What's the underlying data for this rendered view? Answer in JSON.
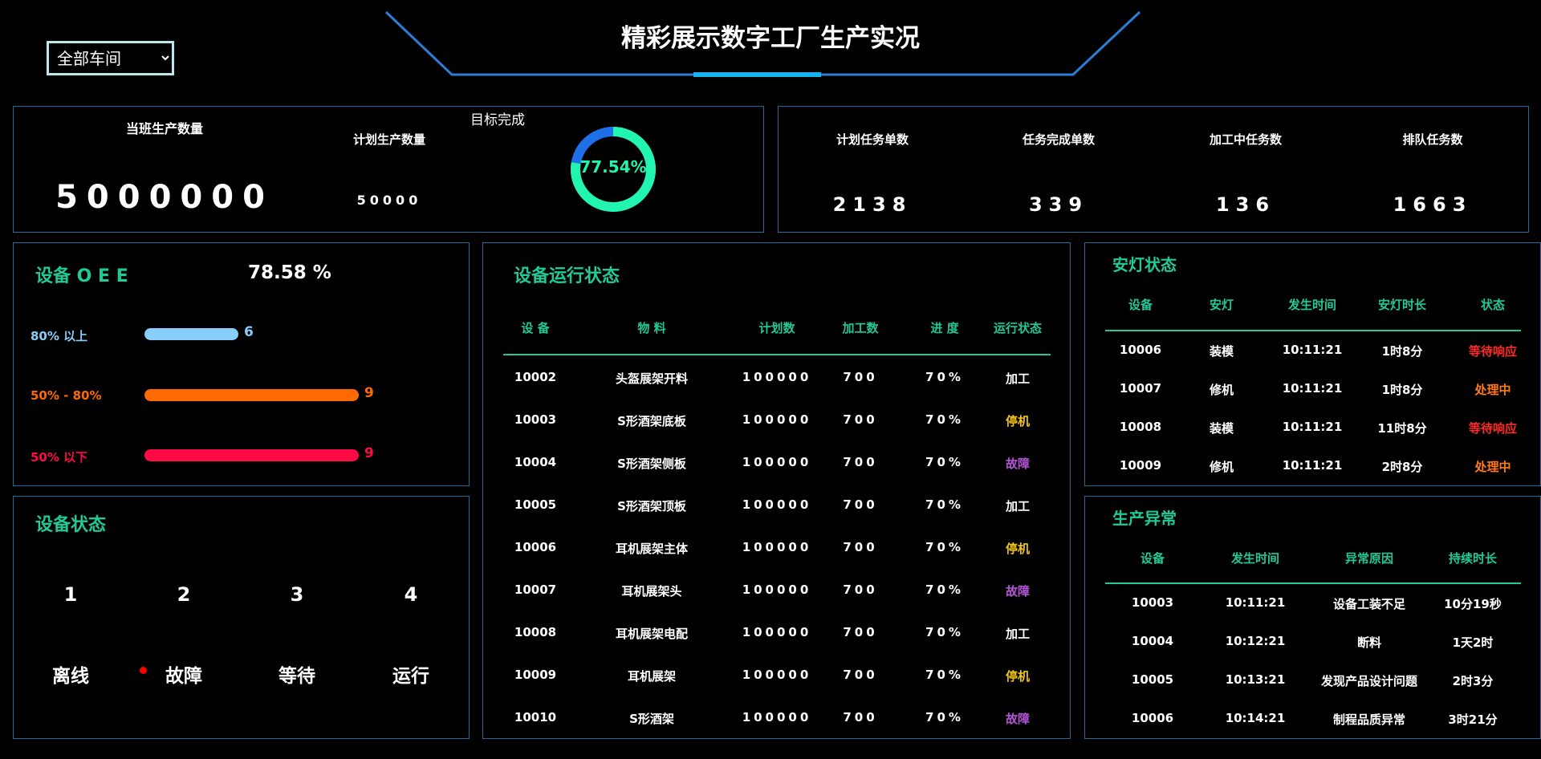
{
  "title": "精彩展示数字工厂生产实况",
  "workshop_select": {
    "value": "全部车间",
    "options": [
      "全部车间"
    ]
  },
  "production": {
    "shift_label": "当班生产数量",
    "shift_value": "5000000",
    "plan_label": "计划生产数量",
    "plan_value": "50000",
    "target_label": "目标完成",
    "target_percent": 77.54,
    "target_text": "77.54%"
  },
  "tasks": [
    {
      "label": "计划任务单数",
      "value": "2138"
    },
    {
      "label": "任务完成单数",
      "value": "339"
    },
    {
      "label": "加工中任务数",
      "value": "136"
    },
    {
      "label": "排队任务数",
      "value": "1663"
    }
  ],
  "oee": {
    "title": "设备 O E E",
    "value": "78.58 %",
    "rows": [
      {
        "label": "80% 以上",
        "count": "6",
        "level": 6,
        "color": "#87cefa"
      },
      {
        "label": "50% - 80%",
        "count": "9",
        "level": 9,
        "color": "#ff6a00"
      },
      {
        "label": "50% 以下",
        "count": "9",
        "level": 9,
        "color": "#ff0a45"
      }
    ]
  },
  "equipment_status": {
    "title": "设备状态",
    "items": [
      {
        "count": "1",
        "label": "离线"
      },
      {
        "count": "2",
        "label": "故障"
      },
      {
        "count": "3",
        "label": "等待"
      },
      {
        "count": "4",
        "label": "运行"
      }
    ]
  },
  "running": {
    "title": "设备运行状态",
    "headers": [
      "设 备",
      "物 料",
      "计划数",
      "加工数",
      "进 度",
      "运行状态"
    ],
    "rows": [
      [
        "10002",
        "头盔展架开料",
        "100000",
        "700",
        "70%",
        "加工"
      ],
      [
        "10003",
        "S形酒架底板",
        "100000",
        "700",
        "70%",
        "停机"
      ],
      [
        "10004",
        "S形酒架侧板",
        "100000",
        "700",
        "70%",
        "故障"
      ],
      [
        "10005",
        "S形酒架顶板",
        "100000",
        "700",
        "70%",
        "加工"
      ],
      [
        "10006",
        "耳机展架主体",
        "100000",
        "700",
        "70%",
        "停机"
      ],
      [
        "10007",
        "耳机展架头",
        "100000",
        "700",
        "70%",
        "故障"
      ],
      [
        "10008",
        "耳机展架电配",
        "100000",
        "700",
        "70%",
        "加工"
      ],
      [
        "10009",
        "耳机展架",
        "100000",
        "700",
        "70%",
        "停机"
      ],
      [
        "10010",
        "S形酒架",
        "100000",
        "700",
        "70%",
        "故障"
      ]
    ],
    "state_colors": {
      "加工": "#ffffff",
      "停机": "#f0c419",
      "故障": "#b455d6"
    }
  },
  "andon": {
    "title": "安灯状态",
    "headers": [
      "设备",
      "安灯",
      "发生时间",
      "安灯时长",
      "状态"
    ],
    "rows": [
      [
        "10006",
        "装模",
        "10:11:21",
        "1时8分",
        "等待响应"
      ],
      [
        "10007",
        "修机",
        "10:11:21",
        "1时8分",
        "处理中"
      ],
      [
        "10008",
        "装模",
        "10:11:21",
        "11时8分",
        "等待响应"
      ],
      [
        "10009",
        "修机",
        "10:11:21",
        "2时8分",
        "处理中"
      ]
    ],
    "state_colors": {
      "等待响应": "#ff2a2a",
      "处理中": "#ff7a1a"
    }
  },
  "abnormal": {
    "title": "生产异常",
    "headers": [
      "设备",
      "发生时间",
      "异常原因",
      "持续时长"
    ],
    "rows": [
      [
        "10003",
        "10:11:21",
        "设备工装不足",
        "10分19秒"
      ],
      [
        "10004",
        "10:12:21",
        "断料",
        "1天2时"
      ],
      [
        "10005",
        "10:13:21",
        "发现产品设计问题",
        "2时3分"
      ],
      [
        "10006",
        "10:14:21",
        "制程品质异常",
        "3时21分"
      ]
    ]
  },
  "colors": {
    "accent": "#20c997",
    "border": "#1a6d9a",
    "header_line": "#2a7fd4",
    "header_glow": "#17b3f0",
    "ring_main": "#22f5b0",
    "ring_rest": "#1e6fe8",
    "fault_dot": "#ff0000"
  }
}
